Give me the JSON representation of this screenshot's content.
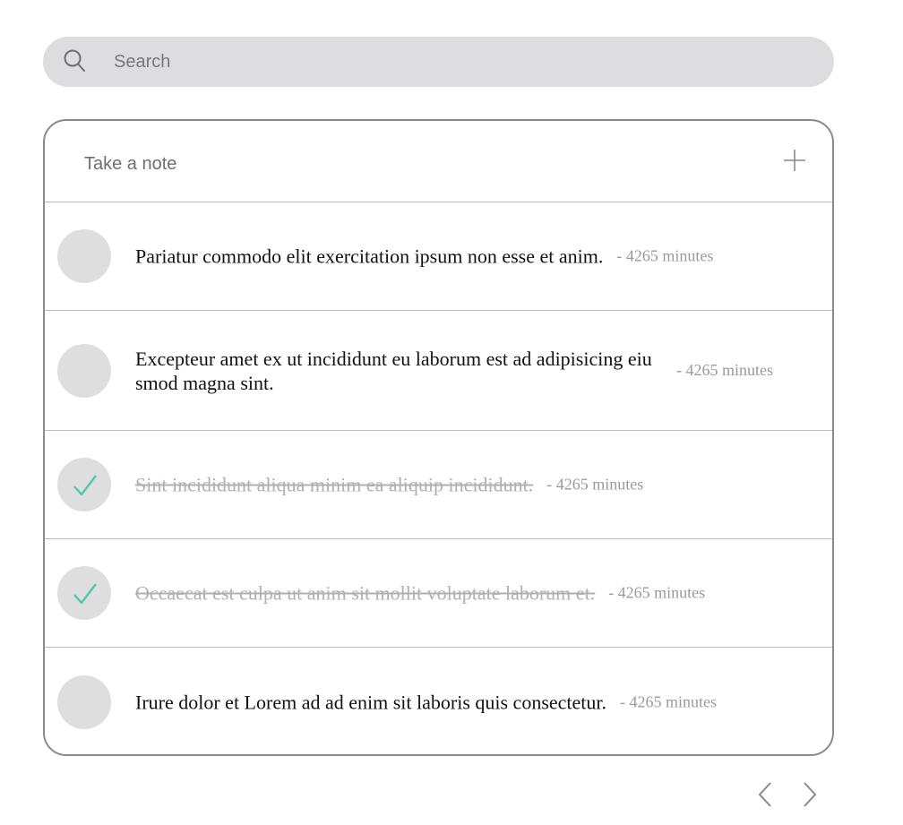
{
  "search": {
    "placeholder": "Search",
    "value": "",
    "icon": "search-icon"
  },
  "note_input": {
    "placeholder": "Take a note",
    "value": "",
    "add_icon": "plus-icon"
  },
  "todos": [
    {
      "text": "Pariatur commodo elit exercitation ipsum non esse et anim.",
      "time": "- 4265 minutes",
      "done": false
    },
    {
      "text": "Excepteur amet ex ut incididunt eu laborum est ad adipisicing eiusmod magna sint.",
      "time": "- 4265 minutes",
      "done": false
    },
    {
      "text": "Sint incididunt aliqua minim ea aliquip incididunt.",
      "time": "- 4265 minutes",
      "done": true
    },
    {
      "text": "Occaecat est culpa ut anim sit mollit voluptate laborum et.",
      "time": "- 4265 minutes",
      "done": true
    },
    {
      "text": "Irure dolor et Lorem ad ad enim sit laboris quis consectetur.",
      "time": "- 4265 minutes",
      "done": false
    }
  ],
  "pagination": {
    "prev_icon": "chevron-left-icon",
    "next_icon": "chevron-right-icon"
  },
  "colors": {
    "search_bg": "#dddddf",
    "check_circle": "#dedede",
    "check_mark": "#4fc7a8",
    "done_text": "#b0b0b0",
    "time_text": "#9a9a9a",
    "card_border": "#8a8a8a"
  }
}
